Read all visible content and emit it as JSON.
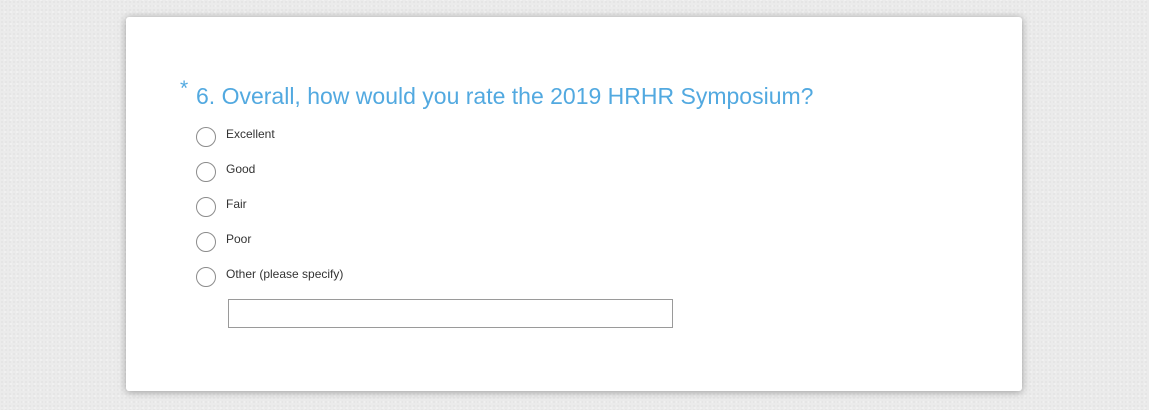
{
  "question": {
    "required_marker": "*",
    "number_and_text": "6. Overall, how would you rate the 2019 HRHR Symposium?",
    "options": [
      {
        "label": "Excellent"
      },
      {
        "label": "Good"
      },
      {
        "label": "Fair"
      },
      {
        "label": "Poor"
      },
      {
        "label": "Other (please specify)"
      }
    ],
    "other_input": {
      "value": "",
      "placeholder": ""
    }
  },
  "colors": {
    "question_text": "#52a9e0",
    "page_background": "#ebebeb",
    "card_background": "#ffffff",
    "radio_border": "#8c8c8c",
    "option_text": "#333333"
  }
}
